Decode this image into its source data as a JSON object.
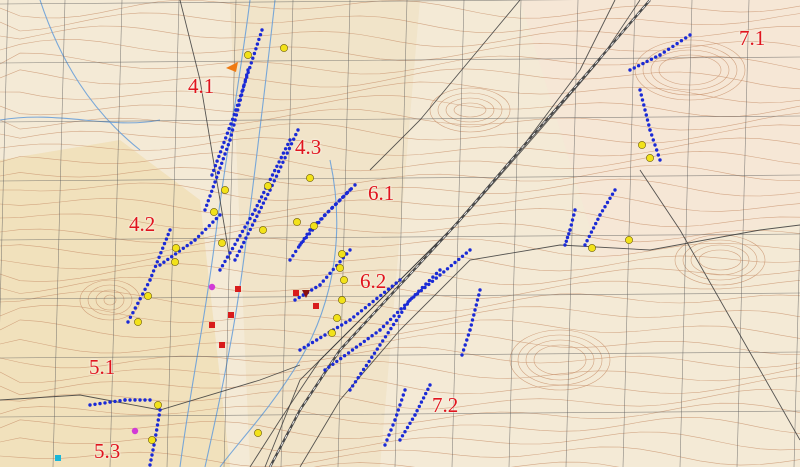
{
  "map": {
    "base_colors": {
      "paper": "#f4ead6",
      "sand": "#efd9a8",
      "grid": "#5c5c5c",
      "contour": "#c8916c",
      "river": "#6aa0d8",
      "road": "#3a3a3a",
      "railway": "#4a4a4a"
    },
    "layers": {
      "topographic_base": true,
      "coordinate_grid": true,
      "contours": true,
      "rivers": true,
      "roads": true,
      "railway": true,
      "survey_points": {
        "color": "#1a2ad6",
        "icon": "blue-survey-dot"
      },
      "yellow_markers": {
        "color": "#f2e21a",
        "icon": "yellow-circle-marker"
      },
      "red_markers": {
        "color": "#d81c1c",
        "icon": "red-square-marker"
      }
    },
    "zone_labels": [
      "4.1",
      "4.2",
      "4.3",
      "5.1",
      "5.3",
      "6.1",
      "6.2",
      "7.1",
      "7.2"
    ],
    "label_color": "#e0141e"
  }
}
